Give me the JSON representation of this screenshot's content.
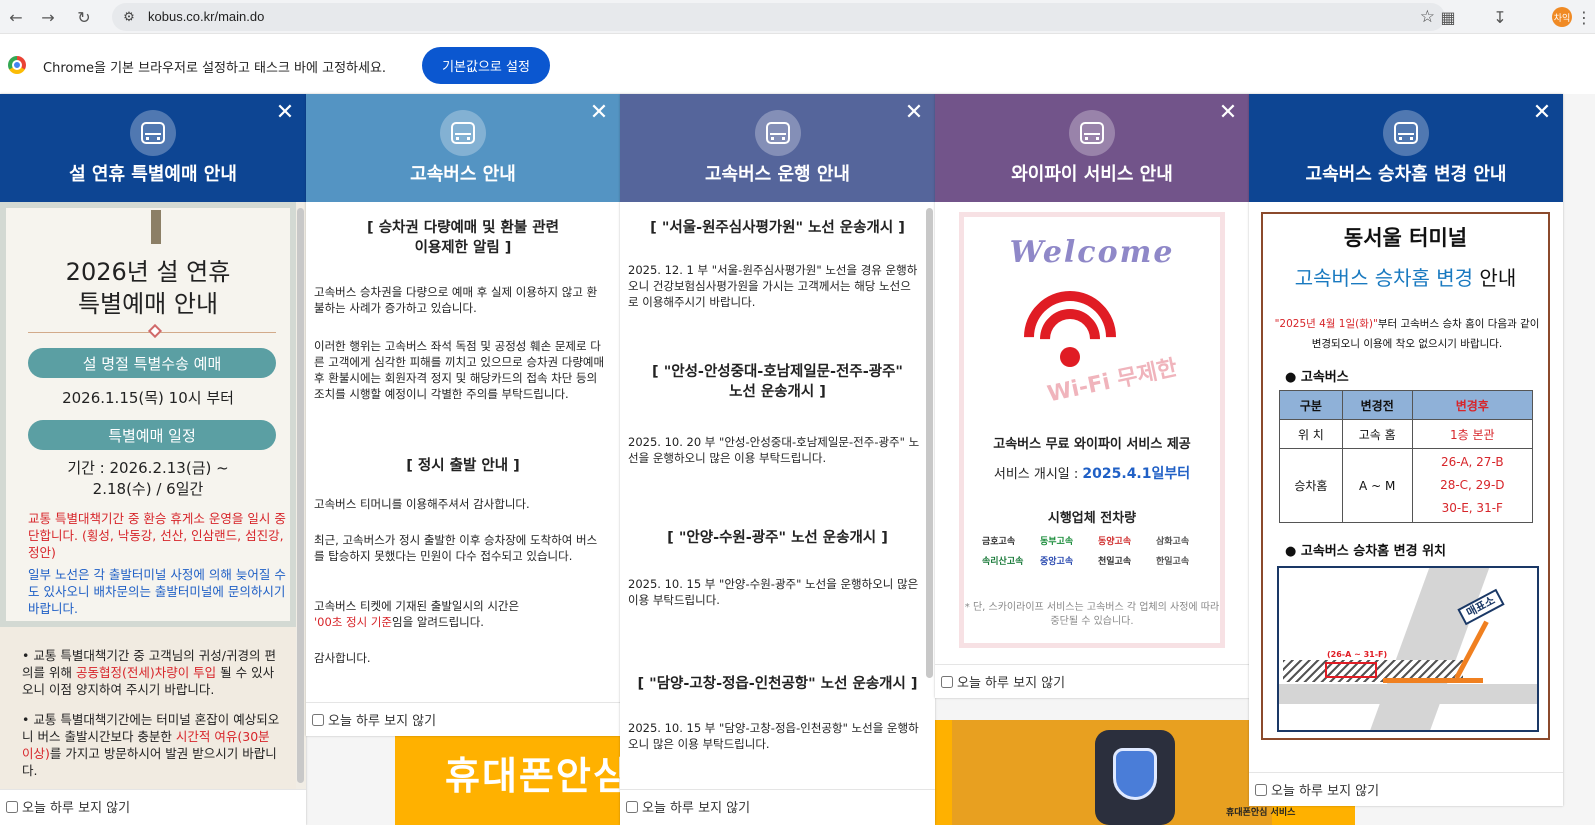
{
  "browser": {
    "url": "kobus.co.kr/main.do",
    "profile_initial": "차익"
  },
  "infobar": {
    "message": "Chrome을 기본 브라우저로 설정하고 태스크 바에 고정하세요.",
    "button": "기본값으로 설정"
  },
  "background": {
    "banner_text": "휴대폰안심 서",
    "banner_small": "휴대폰안심 서비스"
  },
  "dismiss_label": "오늘 하루 보지 않기",
  "colors": {
    "popup1": "#0d4593",
    "popup2": "#5494c3",
    "popup3": "#55659b",
    "popup4": "#72548a",
    "popup5": "#0d4593"
  },
  "popup1": {
    "title": "설 연휴 특별예매 안내",
    "heading_line1": "2026년 설 연휴",
    "heading_line2": "특별예매 안내",
    "pill1": "설 명절 특별수송 예매",
    "date1": "2026.1.15(목) 10시 부터",
    "pill2": "특별예매 일정",
    "period_line1": "기간 : 2026.2.13(금) ~",
    "period_line2": "2.18(수) / 6일간",
    "note1_red": "교통 특별대책기간 중 환승 휴게소 운영을 일시 중단합니다. (횡성, 낙동강, 선산, 인삼랜드, 섬진강, 정안)",
    "note2_blue": "일부 노선은 각 출발터미널 사정에 의해 늦어질 수도 있사오니 배차문의는 출발터미널에 문의하시기 바랍니다.",
    "note3_a": "교통 특별대책기간 중 고객님의 귀성/귀경의 편의를 위해 ",
    "note3_red": "공동협정(전세)차량이 투입",
    "note3_b": " 될 수 있사오니 이점 양지하여 주시기 바랍니다.",
    "note4_a": "교통 특별대책기간에는 터미널 혼잡이 예상되오니 버스 출발시간보다 충분한 ",
    "note4_red": "시간적 여유(30분 이상)",
    "note4_b": "를 가지고 방문하시어 발권 받으시기 바랍니다."
  },
  "popup2": {
    "title": "고속버스 안내",
    "section1_title_line1": "[ 승차권 다량예매 및 환불 관련",
    "section1_title_line2": "이용제한 알림 ]",
    "section1_p1": "고속버스 승차권을 다량으로 예매 후 실제 이용하지 않고 환불하는 사례가 증가하고 있습니다.",
    "section1_p2": "이러한 행위는 고속버스 좌석 독점 및 공정성 훼손 문제로 다른 고객에게 심각한 피해를 끼치고 있으므로 승차권 다량예매 후 환불시에는 회원자격 정지 및 해당카드의 접속 차단 등의 조치를 시행할 예정이니 각별한 주의를 부탁드립니다.",
    "section2_title": "[ 정시 출발 안내 ]",
    "section2_p1": "고속버스 티머니를 이용해주셔서 감사합니다.",
    "section2_p2": "최근, 고속버스가 정시 출발한 이후 승차장에 도착하여 버스를 탑승하지 못했다는 민원이 다수 접수되고 있습니다.",
    "section2_p3": "고속버스 티켓에 기재된 출발일시의 시간은",
    "section2_p3_red": "'00초 정시 기준",
    "section2_p3_b": "임을 알려드립니다.",
    "section2_p4": "감사합니다."
  },
  "popup3": {
    "title": "고속버스 운행 안내",
    "r1_title": "[ \"서울-원주심사평가원\" 노선 운송개시 ]",
    "r1_text": "2025. 12. 1 부 \"서울-원주심사평가원\" 노선을 경유 운행하오니 건강보험심사평가원을 가시는 고객께서는 해당 노선으로 이용해주시기 바랍니다.",
    "r2_title_line1": "[ \"안성-안성중대-호남제일문-전주-광주\"",
    "r2_title_line2": "노선 운송개시 ]",
    "r2_text": "2025. 10. 20 부 \"안성-안성중대-호남제일문-전주-광주\" 노선을 운행하오니 많은 이용 부탁드립니다.",
    "r3_title": "[ \"안양-수원-광주\" 노선 운송개시 ]",
    "r3_text": "2025. 10. 15 부 \"안양-수원-광주\" 노선을 운행하오니 많은 이용 부탁드립니다.",
    "r4_title": "[ \"담양-고창-정읍-인천공항\" 노선 운송개시 ]",
    "r4_text": "2025. 10. 15 부 \"담양-고창-정읍-인천공항\" 노선을 운행하오니 많은 이용 부탁드립니다."
  },
  "popup4": {
    "title": "와이파이 서비스 안내",
    "welcome": "Welcome",
    "free": "Wi-Fi 무제한",
    "line1": "고속버스 무료 와이파이 서비스 제공",
    "line2_label": "서비스 개시일 : ",
    "line2_value": "2025.4.1일부터",
    "line3": "시행업체 전차량",
    "companies": [
      "금호고속",
      "동부고속",
      "동양고속",
      "삼화고속",
      "속리산고속",
      "중앙고속",
      "천일고속",
      "한일고속"
    ],
    "note": "* 단, 스카이라이프 서비스는 고속버스 각 업체의 사정에 따라 중단될 수 있습니다."
  },
  "popup5": {
    "title": "고속버스 승차홈 변경 안내",
    "h1": "동서울 터미널",
    "h2_blue": "고속버스 승차홈 변경",
    "h2_rest": " 안내",
    "note_red": "\"2025년 4월 1일(화)\"",
    "note_rest": "부터 고속버스 승차 홈이 다음과 같이 변경되오니 이용에 착오 없으시기 바랍니다.",
    "sub1": "● 고속버스",
    "table": {
      "headers": [
        "구분",
        "변경전",
        "변경후"
      ],
      "row1": [
        "위 치",
        "고속 홈",
        "1층 본관"
      ],
      "row2_label": "승차홈",
      "row2_before": "A ~ M",
      "row2_after": [
        "26-A, 27-B",
        "28-C, 29-D",
        "30-E, 31-F"
      ]
    },
    "sub2": "● 고속버스 승차홈 변경 위치",
    "map_platform": "(26-A ~ 31-F)",
    "map_kiosk": "매표소"
  }
}
